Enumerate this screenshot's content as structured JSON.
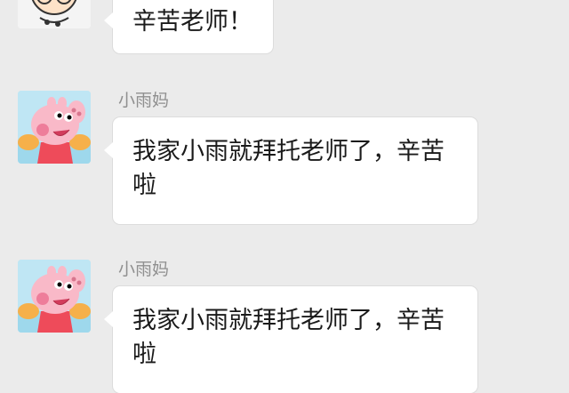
{
  "messages": [
    {
      "sender": "",
      "text": "辛苦老师！",
      "avatar": "teacher-cartoon-avatar"
    },
    {
      "sender": "小雨妈",
      "text": "我家小雨就拜托老师了，辛苦啦",
      "avatar": "peppa-pig-avatar"
    },
    {
      "sender": "小雨妈",
      "text": "我家小雨就拜托老师了，辛苦啦",
      "avatar": "peppa-pig-avatar"
    }
  ],
  "colors": {
    "background": "#ebebeb",
    "bubble": "#ffffff",
    "sender_name": "#8f8f8f"
  }
}
